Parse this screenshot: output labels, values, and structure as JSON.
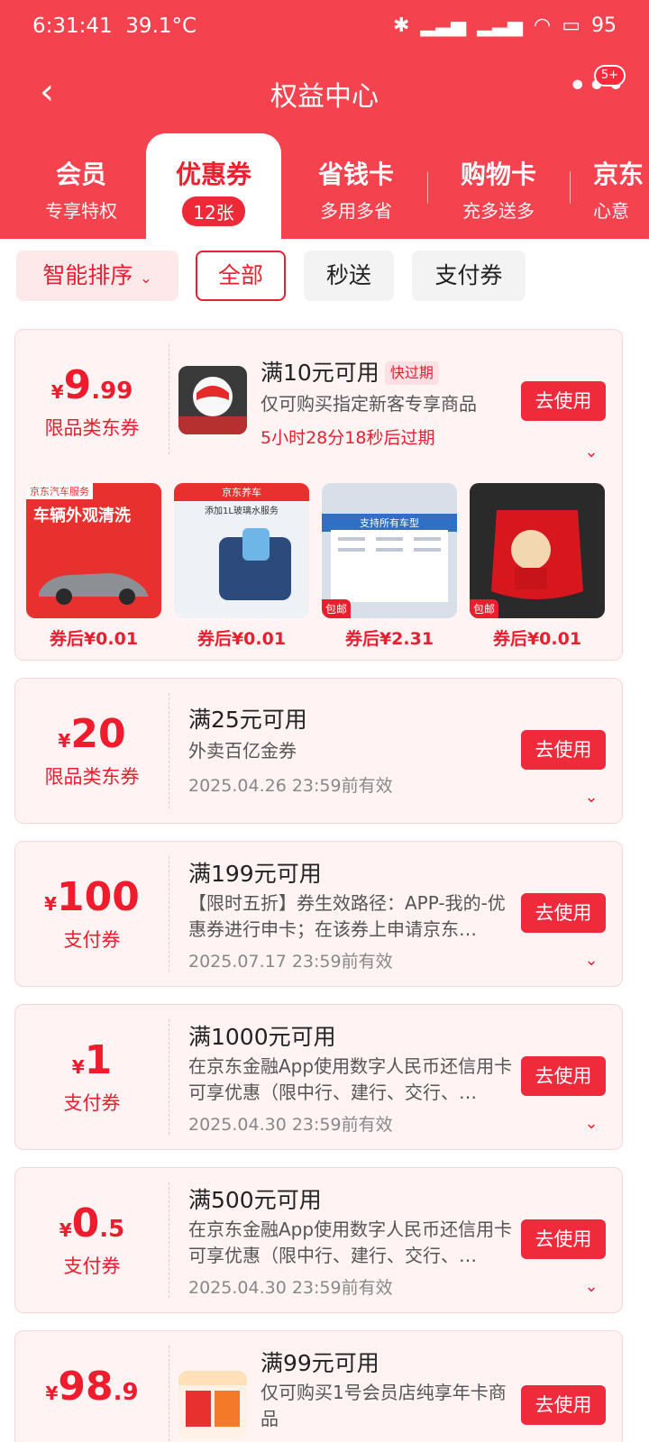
{
  "status": {
    "time": "6:31:41",
    "temp": "39.1°C",
    "battery": "95"
  },
  "topbar": {
    "back_icon": "chevron-left-icon",
    "title": "权益中心",
    "more_badge": "5+"
  },
  "tabs": [
    {
      "title": "会员",
      "sub": "专享特权"
    },
    {
      "title": "优惠券",
      "sub": "12张"
    },
    {
      "title": "省钱卡",
      "sub": "多用多省"
    },
    {
      "title": "购物卡",
      "sub": "充多送多"
    },
    {
      "title": "京东",
      "sub": "心意"
    }
  ],
  "filters": {
    "sort": "智能排序",
    "all": "全部",
    "fast": "秒送",
    "pay": "支付券"
  },
  "coupons": [
    {
      "cur": "¥",
      "int": "9",
      "dec": ".99",
      "type": "限品类东券",
      "cond": "满10元可用",
      "tag": "快过期",
      "desc": "仅可购买指定新客专享商品",
      "expire": "5小时28分18秒后过期",
      "btn": "去使用",
      "products": [
        {
          "price": "券后¥0.01",
          "label": "车辆外观清洗",
          "top": "京东汽车服务"
        },
        {
          "price": "券后¥0.01",
          "label": "添加1L玻璃水服务",
          "top": "京东养车"
        },
        {
          "price": "券后¥2.31",
          "label": "支持所有车型",
          "top": ""
        },
        {
          "price": "券后¥0.01",
          "label": "包邮",
          "top": ""
        }
      ]
    },
    {
      "cur": "¥",
      "int": "20",
      "dec": "",
      "type": "限品类东券",
      "cond": "满25元可用",
      "desc": "外卖百亿金券",
      "valid": "2025.04.26 23:59前有效",
      "btn": "去使用"
    },
    {
      "cur": "¥",
      "int": "100",
      "dec": "",
      "type": "支付券",
      "cond": "满199元可用",
      "desc": "【限时五折】券生效路径：APP-我的-优惠券进行申卡；在该券上申请京东…",
      "valid": "2025.07.17 23:59前有效",
      "btn": "去使用"
    },
    {
      "cur": "¥",
      "int": "1",
      "dec": "",
      "type": "支付券",
      "cond": "满1000元可用",
      "desc": "在京东金融App使用数字人民币还信用卡可享优惠（限中行、建行、交行、…",
      "valid": "2025.04.30 23:59前有效",
      "btn": "去使用"
    },
    {
      "cur": "¥",
      "int": "0",
      "dec": ".5",
      "type": "支付券",
      "cond": "满500元可用",
      "desc": "在京东金融App使用数字人民币还信用卡可享优惠（限中行、建行、交行、…",
      "valid": "2025.04.30 23:59前有效",
      "btn": "去使用"
    },
    {
      "cur": "¥",
      "int": "98",
      "dec": ".9",
      "type": "",
      "cond": "满99元可用",
      "desc": "仅可购买1号会员店纯享年卡商品",
      "btn": "去使用"
    }
  ]
}
